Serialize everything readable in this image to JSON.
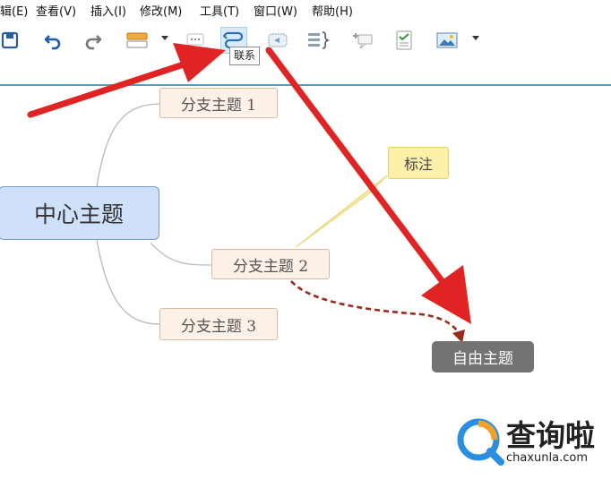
{
  "menubar": {
    "items": [
      "辑(E)",
      "查看(V)",
      "插入(I)",
      "修改(M)",
      "工具(T)",
      "窗口(W)",
      "帮助(H)"
    ]
  },
  "toolbar": {
    "buttons": [
      "save-icon",
      "undo-icon",
      "redo-icon",
      "topic-style-icon",
      "comment-icon",
      "relationship-icon",
      "boundary-icon",
      "summary-icon",
      "add-callout-icon",
      "task-icon",
      "image-icon"
    ],
    "tooltip": "联系"
  },
  "mindmap": {
    "central": "中心主题",
    "subtopics": [
      "分支主题 1",
      "分支主题 2",
      "分支主题 3"
    ],
    "callout": "标注",
    "floating": "自由主题"
  },
  "watermark": {
    "text": "查询啦",
    "sub": "chaxunla.com"
  },
  "colors": {
    "accent": "#4aa3c4",
    "arrow": "#e02424",
    "relationship": "#9b2a1c"
  }
}
